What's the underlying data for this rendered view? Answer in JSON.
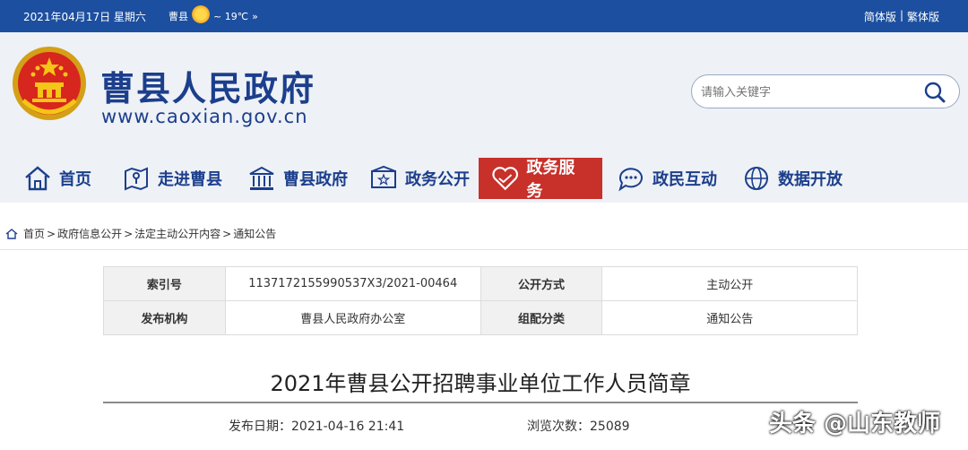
{
  "topbar": {
    "date": "2021年04月17日 星期六",
    "city": "曹县",
    "weather_icon": "sun-icon",
    "temperature": "~ 19℃",
    "more": "»",
    "simplified": "简体版",
    "separator": "|",
    "traditional": "繁体版"
  },
  "header": {
    "site_title": "曹县人民政府",
    "site_url": "www.caoxian.gov.cn",
    "search_placeholder": "请输入关键字",
    "brand_blue": "#1c3f8c",
    "bar_blue": "#1c4f9f"
  },
  "nav": {
    "items": [
      {
        "label": "首页",
        "icon": "home-icon"
      },
      {
        "label": "走进曹县",
        "icon": "map-icon"
      },
      {
        "label": "曹县政府",
        "icon": "building-icon"
      },
      {
        "label": "政务公开",
        "icon": "notice-icon"
      },
      {
        "label": "政务服务",
        "icon": "heart-service-icon"
      },
      {
        "label": "政民互动",
        "icon": "chat-icon"
      },
      {
        "label": "数据开放",
        "icon": "globe-icon"
      }
    ],
    "active_index": 4,
    "active_color": "#c8302a"
  },
  "breadcrumb": {
    "home": "首页",
    "items": [
      "政府信息公开",
      "法定主动公开内容",
      "通知公告"
    ],
    "sep": ">"
  },
  "info": {
    "index_label": "索引号",
    "index_value": "1137172155990537X3/2021-00464",
    "mode_label": "公开方式",
    "mode_value": "主动公开",
    "publisher_label": "发布机构",
    "publisher_value": "曹县人民政府办公室",
    "category_label": "组配分类",
    "category_value": "通知公告"
  },
  "article": {
    "title": "2021年曹县公开招聘事业单位工作人员简章",
    "date_label": "发布日期：",
    "date_value": "2021-04-16 21:41",
    "views_label": "浏览次数：",
    "views_value": "25089"
  },
  "watermark": "头条 @山东教师"
}
